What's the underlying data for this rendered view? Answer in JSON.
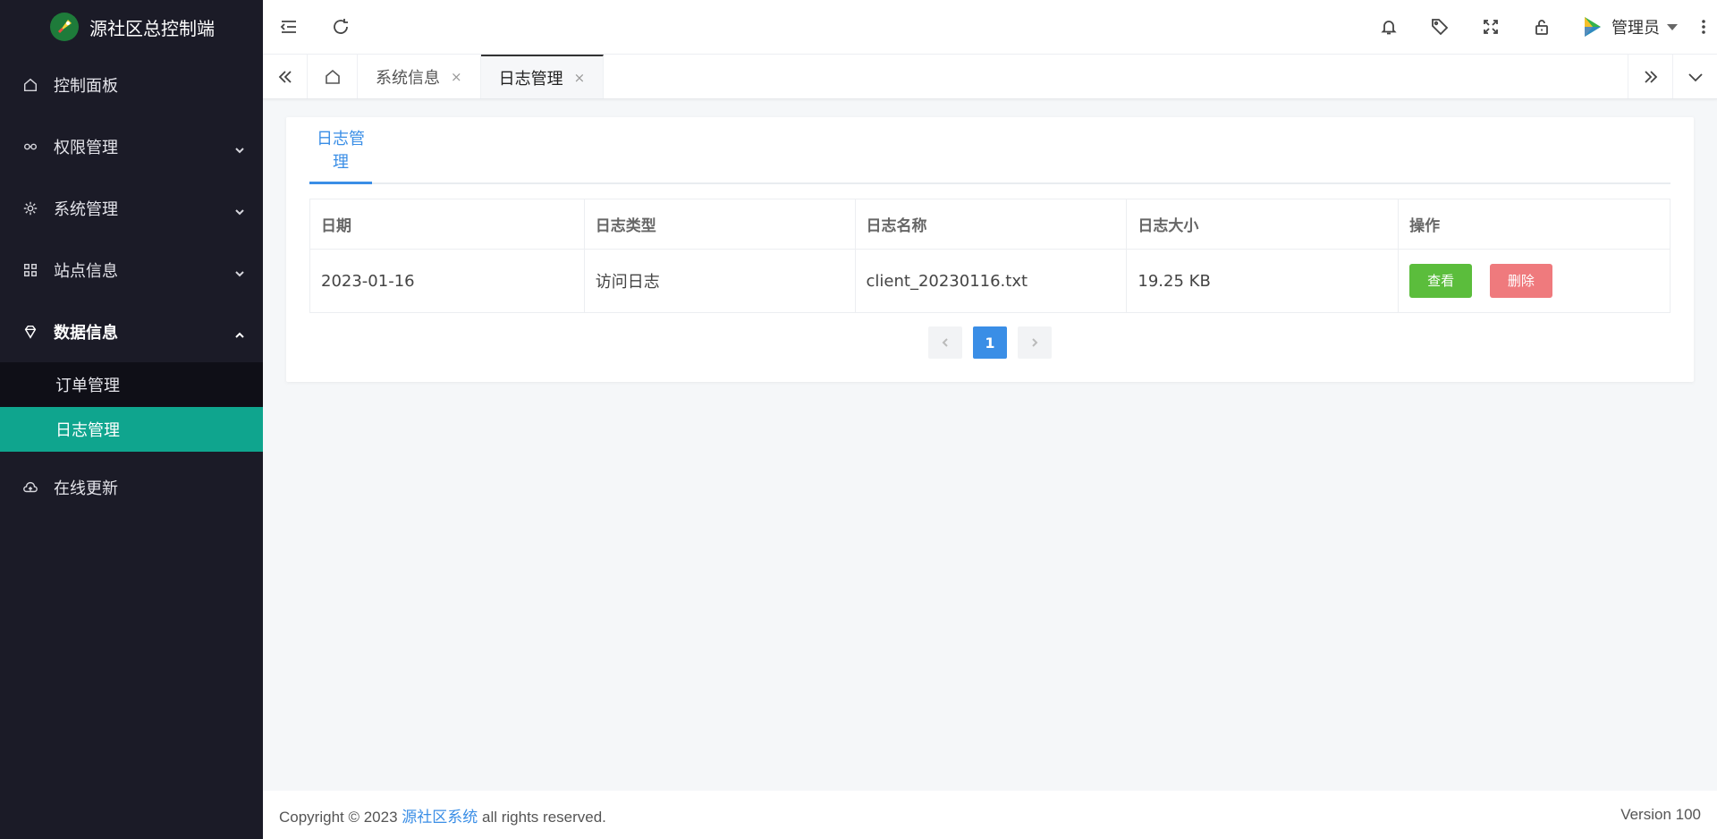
{
  "sidebar": {
    "logo_title": "源社区总控制端",
    "items": [
      {
        "label": "控制面板",
        "icon": "home-icon"
      },
      {
        "label": "权限管理",
        "icon": "link-icon"
      },
      {
        "label": "系统管理",
        "icon": "gear-icon"
      },
      {
        "label": "站点信息",
        "icon": "apps-icon"
      },
      {
        "label": "数据信息",
        "icon": "diamond-icon"
      },
      {
        "label": "在线更新",
        "icon": "cloud-icon"
      }
    ],
    "submenu": [
      {
        "label": "订单管理"
      },
      {
        "label": "日志管理"
      }
    ],
    "accent_color": "#0fa58e"
  },
  "header": {
    "user_name": "管理员"
  },
  "tabs": [
    {
      "label": "系统信息",
      "close": "×"
    },
    {
      "label": "日志管理",
      "close": "×"
    }
  ],
  "content": {
    "tab_label": "日志管理",
    "columns": [
      "日期",
      "日志类型",
      "日志名称",
      "日志大小",
      "操作"
    ],
    "rows": [
      {
        "date": "2023-01-16",
        "type": "访问日志",
        "name": "client_20230116.txt",
        "size": "19.25 KB",
        "view_label": "查看",
        "delete_label": "删除"
      }
    ],
    "pagination": {
      "current": "1"
    }
  },
  "footer": {
    "copyright_prefix": "Copyright © 2023 ",
    "brand": "源社区系统",
    "copyright_suffix": " all rights reserved.",
    "version": "Version 100"
  }
}
